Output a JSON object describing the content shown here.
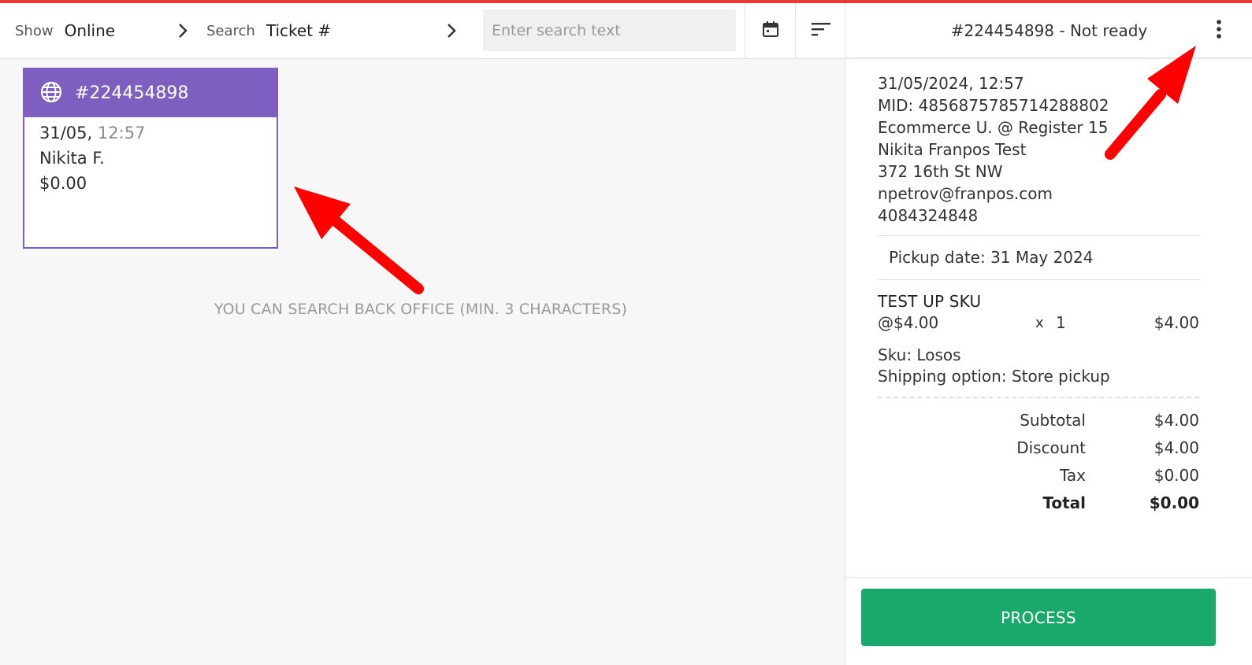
{
  "toolbar": {
    "show_label": "Show",
    "show_value": "Online",
    "search_label": "Search",
    "search_value": "Ticket #",
    "search_placeholder": "Enter search text",
    "calendar_icon": "calendar-icon",
    "sort_icon": "sort-icon"
  },
  "ticket": {
    "number": "#224454898",
    "icon": "globe-icon",
    "date": "31/05,",
    "time": "12:57",
    "customer": "Nikita F.",
    "amount": "$0.00"
  },
  "hint": "YOU CAN SEARCH BACK OFFICE (MIN. 3 CHARACTERS)",
  "detail": {
    "title": "#224454898 - Not ready",
    "info_lines": [
      "31/05/2024, 12:57",
      "MID: 4856875785714288802",
      "Ecommerce U. @ Register 15",
      "Nikita Franpos Test",
      "372 16th St NW",
      "npetrov@franpos.com",
      "4084324848"
    ],
    "pickup": "Pickup date: 31 May 2024",
    "item": {
      "name": "TEST UP SKU",
      "unit_price": "@$4.00",
      "x": "x",
      "qty": "1",
      "price": "$4.00",
      "sku": "Sku: Losos",
      "shipping": "Shipping option: Store pickup"
    },
    "totals": {
      "subtotal_label": "Subtotal",
      "subtotal": "$4.00",
      "discount_label": "Discount",
      "discount": "$4.00",
      "tax_label": "Tax",
      "tax": "$0.00",
      "total_label": "Total",
      "total": "$0.00"
    },
    "process_label": "PROCESS"
  },
  "colors": {
    "accent": "#7e5fc0",
    "process": "#19a96b",
    "annotation": "#ff0000",
    "top_bar": "#e53935"
  }
}
